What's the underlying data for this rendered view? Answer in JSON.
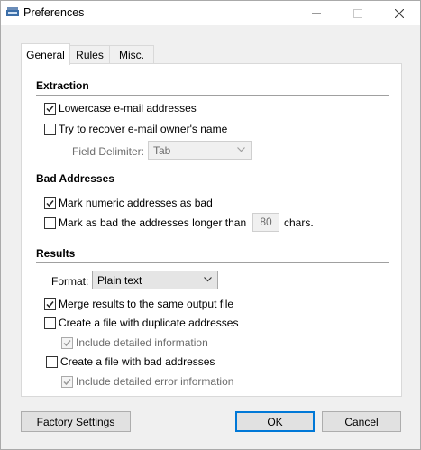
{
  "window": {
    "title": "Preferences"
  },
  "tabs": [
    {
      "label": "General"
    },
    {
      "label": "Rules"
    },
    {
      "label": "Misc."
    }
  ],
  "extraction": {
    "title": "Extraction",
    "lowercase": {
      "label": "Lowercase e-mail addresses",
      "checked": true
    },
    "recover_name": {
      "label": "Try to recover e-mail owner's name",
      "checked": false
    },
    "field_delimiter": {
      "label": "Field Delimiter:",
      "value": "Tab"
    }
  },
  "bad_addresses": {
    "title": "Bad Addresses",
    "mark_numeric": {
      "label": "Mark numeric addresses as bad",
      "checked": true
    },
    "mark_longer": {
      "label": "Mark as bad the addresses longer than",
      "checked": false,
      "value": "80",
      "suffix": "chars."
    }
  },
  "results": {
    "title": "Results",
    "format": {
      "label": "Format:",
      "value": "Plain text"
    },
    "merge": {
      "label": "Merge results to the same output file",
      "checked": true
    },
    "duplicates": {
      "label": "Create a file with duplicate addresses",
      "checked": false
    },
    "duplicates_detail": {
      "label": "Include detailed information",
      "checked": true
    },
    "bad_file": {
      "label": "Create a file with bad addresses",
      "checked": false
    },
    "bad_file_detail": {
      "label": "Include detailed error information",
      "checked": true
    }
  },
  "buttons": {
    "factory": "Factory Settings",
    "ok": "OK",
    "cancel": "Cancel"
  },
  "colors": {
    "focus_border": "#0078d7",
    "panel_bg": "#ffffff",
    "window_bg": "#f0f0f0"
  }
}
